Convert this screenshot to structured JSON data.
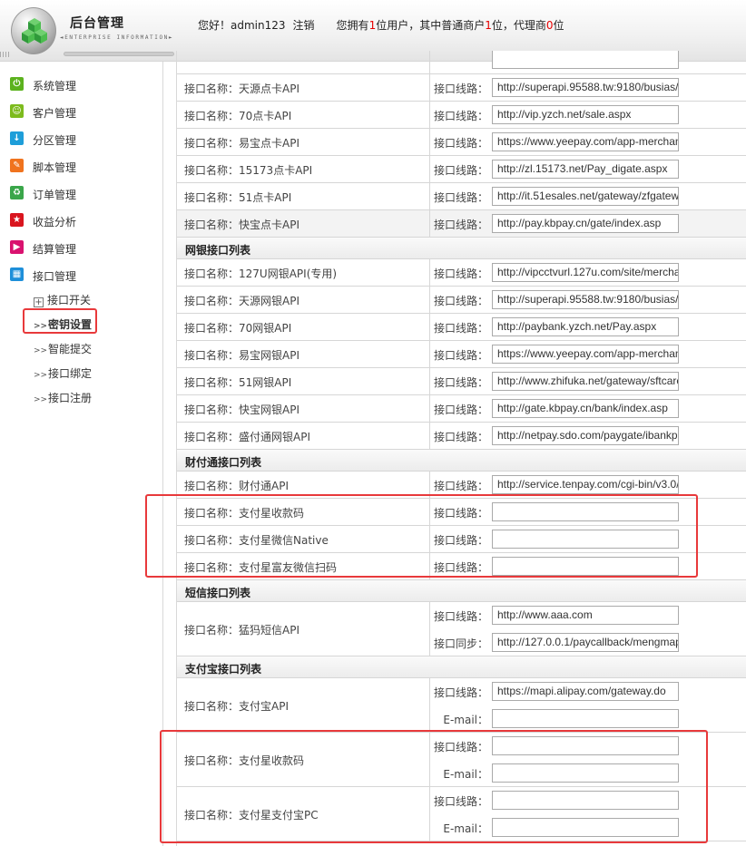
{
  "header": {
    "title": "后台管理",
    "subtitle": "◄ENTERPRISE INFORMATION►",
    "greeting_prefix": "您好！",
    "username": "admin123",
    "logout": "注销",
    "stats_prefix": "您拥有",
    "user_count": "1",
    "stats_mid": "位用户，其中普通商户",
    "merchant_count": "1",
    "stats_mid2": "位，代理商",
    "agent_count": "0",
    "stats_suffix": "位"
  },
  "sidebar": {
    "items": [
      {
        "label": "系统管理",
        "icon": "power-icon",
        "color": "#5cb21e"
      },
      {
        "label": "客户管理",
        "icon": "smile-icon",
        "color": "#7dbb1d"
      },
      {
        "label": "分区管理",
        "icon": "download-icon",
        "color": "#1e9ed9"
      },
      {
        "label": "脚本管理",
        "icon": "pencil-icon",
        "color": "#f0731e"
      },
      {
        "label": "订单管理",
        "icon": "recycle-icon",
        "color": "#3aa64a"
      },
      {
        "label": "收益分析",
        "icon": "star-icon",
        "color": "#d9151e"
      },
      {
        "label": "结算管理",
        "icon": "play-icon",
        "color": "#d9126f"
      },
      {
        "label": "接口管理",
        "icon": "grid-icon",
        "color": "#1e8fd9"
      }
    ],
    "sub_items": [
      {
        "label": "接口开关",
        "prefix": "+"
      },
      {
        "label": "密钥设置",
        "prefix": ">>"
      },
      {
        "label": "智能提交",
        "prefix": ">>"
      },
      {
        "label": "接口绑定",
        "prefix": ">>"
      },
      {
        "label": "接口注册",
        "prefix": ">>"
      }
    ]
  },
  "labels": {
    "name_prefix": "接口名称：",
    "line": "接口线路：",
    "sync": "接口同步：",
    "email": "E-mail："
  },
  "card_rows": [
    {
      "name": "天源点卡API",
      "url": "http://superapi.95588.tw:9180/busias/"
    },
    {
      "name": "70点卡API",
      "url": "http://vip.yzch.net/sale.aspx"
    },
    {
      "name": "易宝点卡API",
      "url": "https://www.yeepay.com/app-merchan"
    },
    {
      "name": "15173点卡API",
      "url": "http://zl.15173.net/Pay_digate.aspx"
    },
    {
      "name": "51点卡API",
      "url": "http://it.51esales.net/gateway/zfgatew"
    },
    {
      "name": "快宝点卡API",
      "url": "http://pay.kbpay.cn/gate/index.asp"
    }
  ],
  "sections": {
    "bank": "网银接口列表",
    "tenpay": "财付通接口列表",
    "sms": "短信接口列表",
    "alipay": "支付宝接口列表"
  },
  "bank_rows": [
    {
      "name": "127U网银API(专用)",
      "url": "http://vipcctvurl.127u.com/site/mercha"
    },
    {
      "name": "天源网银API",
      "url": "http://superapi.95588.tw:9180/busias/"
    },
    {
      "name": "70网银API",
      "url": "http://paybank.yzch.net/Pay.aspx"
    },
    {
      "name": "易宝网银API",
      "url": "https://www.yeepay.com/app-merchan"
    },
    {
      "name": "51网银API",
      "url": "http://www.zhifuka.net/gateway/sftcarc"
    },
    {
      "name": "快宝网银API",
      "url": "http://gate.kbpay.cn/bank/index.asp"
    },
    {
      "name": "盛付通网银API",
      "url": "http://netpay.sdo.com/paygate/ibankpa"
    }
  ],
  "tenpay_rows": [
    {
      "name": "财付通API",
      "url": "http://service.tenpay.com/cgi-bin/v3.0/"
    },
    {
      "name": "支付星收款码",
      "url": ""
    },
    {
      "name": "支付星微信Native",
      "url": ""
    },
    {
      "name": "支付星富友微信扫码",
      "url": ""
    }
  ],
  "sms_row": {
    "name": "猛犸短信API",
    "url": "http://www.aaa.com",
    "sync": "http://127.0.0.1/paycallback/mengmap"
  },
  "alipay_rows": [
    {
      "name": "支付宝API",
      "url": "https://mapi.alipay.com/gateway.do",
      "email": ""
    },
    {
      "name": "支付星收款码",
      "url": "",
      "email": ""
    },
    {
      "name": "支付星支付宝PC",
      "url": "",
      "email": ""
    }
  ],
  "colors": {
    "highlight": "#e8393b",
    "count_red": "#e60000"
  }
}
